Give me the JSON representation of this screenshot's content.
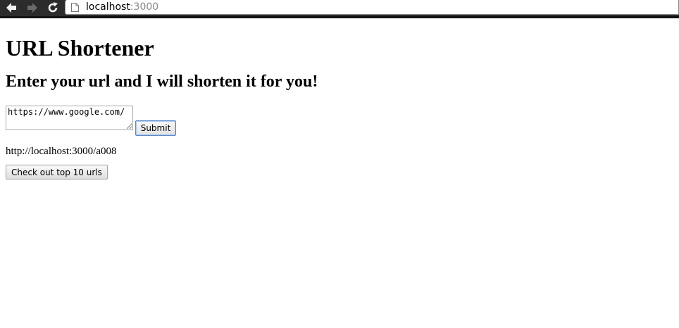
{
  "browser": {
    "url_host": "localhost",
    "url_port": ":3000"
  },
  "page": {
    "title": "URL Shortener",
    "subtitle": "Enter your url and I will shorten it for you!",
    "url_input_value": "https://www.google.com/",
    "submit_label": "Submit",
    "short_url": "http://localhost:3000/a008",
    "top10_label": "Check out top 10 urls"
  },
  "icons": {
    "back": "back-arrow-icon",
    "forward": "forward-arrow-icon",
    "reload": "reload-icon",
    "page": "page-icon"
  }
}
